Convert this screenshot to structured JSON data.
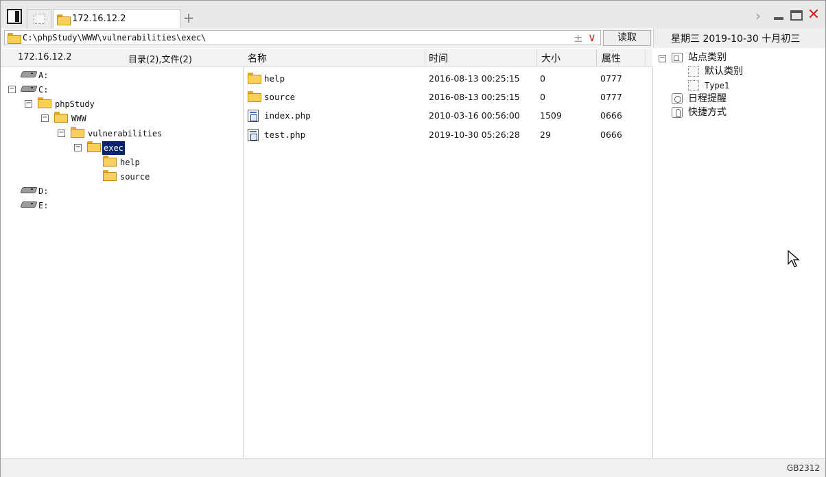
{
  "titlebar": {
    "tab_label": "172.16.12.2",
    "add_tab": "+",
    "next": "›",
    "close": "✕"
  },
  "address": {
    "path": "C:\\phpStudy\\WWW\\vulnerabilities\\exec\\",
    "plus_minus": "±",
    "dropdown": "∨",
    "read_button": "读取"
  },
  "date_bar": {
    "text": "星期三 2019-10-30 十月初三"
  },
  "left_header": {
    "host": "172.16.12.2",
    "counts": "目录(2),文件(2)"
  },
  "file_columns": {
    "name": "名称",
    "time": "时间",
    "size": "大小",
    "attr": "属性"
  },
  "tree": {
    "drive_a": "A:",
    "drive_c": "C:",
    "phpstudy": "phpStudy",
    "www": "WWW",
    "vulnerabilities": "vulnerabilities",
    "exec": "exec",
    "help": "help",
    "source": "source",
    "drive_d": "D:",
    "drive_e": "E:",
    "collapse_symbol": "−"
  },
  "files": [
    {
      "name": "help",
      "time": "2016-08-13 00:25:15",
      "size": "0",
      "attr": "0777",
      "type": "folder"
    },
    {
      "name": "source",
      "time": "2016-08-13 00:25:15",
      "size": "0",
      "attr": "0777",
      "type": "folder"
    },
    {
      "name": "index.php",
      "time": "2010-03-16 00:56:00",
      "size": "1509",
      "attr": "0666",
      "type": "php"
    },
    {
      "name": "test.php",
      "time": "2019-10-30 05:26:28",
      "size": "29",
      "attr": "0666",
      "type": "php"
    }
  ],
  "site_panel": {
    "category_root": "站点类别",
    "default_category": "默认类别",
    "type1": "Type1",
    "schedule": "日程提醒",
    "shortcuts": "快捷方式",
    "collapse_symbol": "−"
  },
  "status": {
    "encoding": "GB2312"
  },
  "colors": {
    "selection": "#0a246a",
    "close_red": "#e02020",
    "folder_yellow": "#f7cf5a"
  }
}
